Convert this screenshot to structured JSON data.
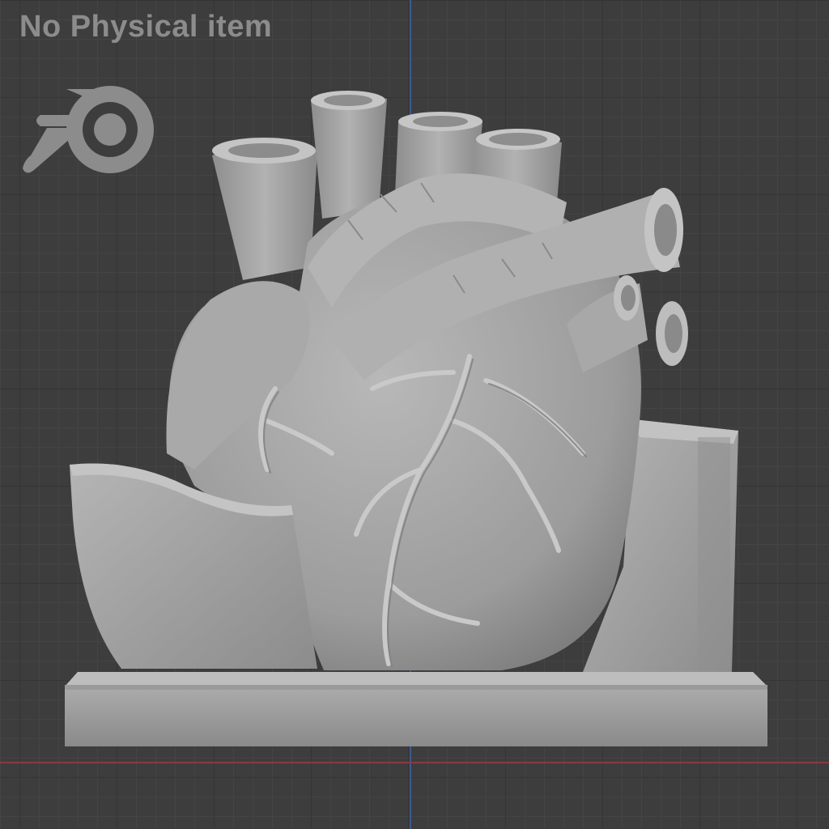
{
  "watermark": {
    "text": "No Physical item",
    "logo_icon": "blender-logo-icon",
    "color": "#8c8c8c"
  },
  "viewport": {
    "background": "#3d3d3d",
    "grid_minor": "#444444",
    "grid_major": "#353535",
    "x_axis_color": "#8a3a44",
    "y_axis_color": "#3b5a8c",
    "model_color": "#a7a7a7"
  }
}
